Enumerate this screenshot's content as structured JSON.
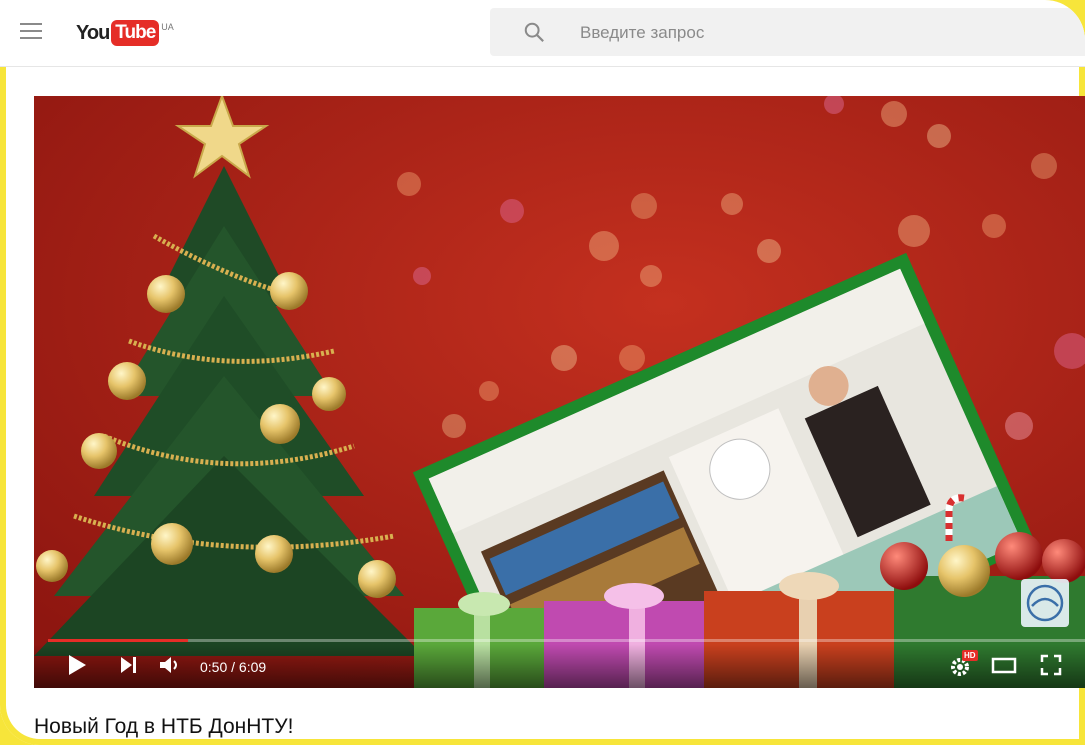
{
  "header": {
    "logo_you": "You",
    "logo_tube": "Tube",
    "logo_country": "UA",
    "search_placeholder": "Введите запрос"
  },
  "player": {
    "current_time": "0:50",
    "separator": " / ",
    "duration": "6:09",
    "progress": 0.135,
    "quality_badge": "HD"
  },
  "video": {
    "title": "Новый Год в НТБ ДонНТУ!"
  },
  "colors": {
    "accent": "#e52d27",
    "page_border": "#f7e53a",
    "video_bg": "#a81d16"
  }
}
